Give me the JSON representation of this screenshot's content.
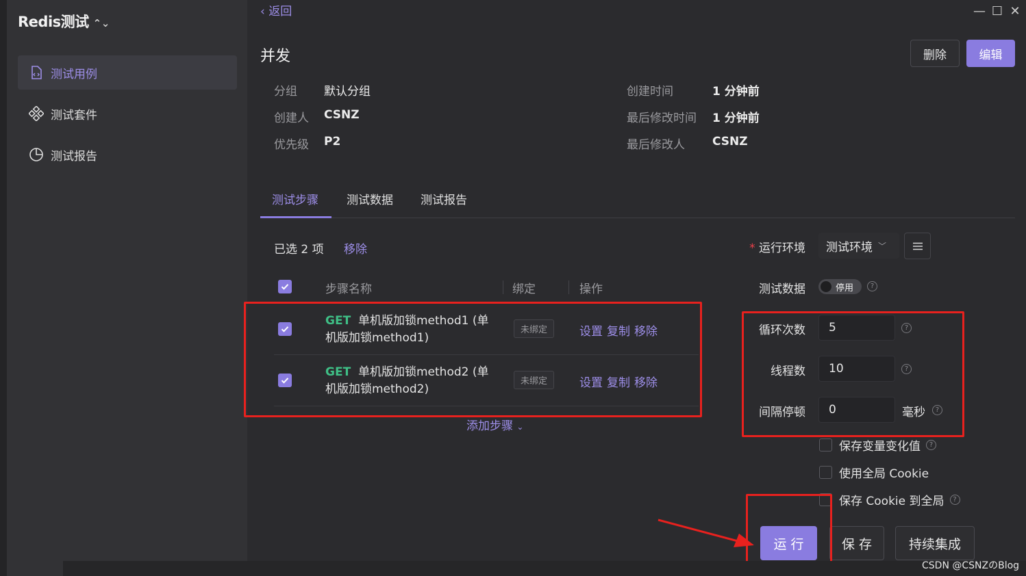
{
  "sidebar": {
    "app_title": "Redis测试",
    "items": [
      {
        "label": "测试用例",
        "icon": "file-code-icon"
      },
      {
        "label": "测试套件",
        "icon": "suite-icon"
      },
      {
        "label": "测试报告",
        "icon": "pie-chart-icon"
      }
    ]
  },
  "header": {
    "back_label": "返回",
    "title": "并发",
    "delete_label": "删除",
    "edit_label": "编辑"
  },
  "meta": {
    "group_label": "分组",
    "group_value": "默认分组",
    "creator_label": "创建人",
    "creator_value": "CSNZ",
    "priority_label": "优先级",
    "priority_value": "P2",
    "created_label": "创建时间",
    "created_value": "1 分钟前",
    "modified_label": "最后修改时间",
    "modified_value": "1 分钟前",
    "modifier_label": "最后修改人",
    "modifier_value": "CSNZ"
  },
  "tabs": [
    "测试步骤",
    "测试数据",
    "测试报告"
  ],
  "steps": {
    "selected_text": "已选 2 项",
    "remove_label": "移除",
    "columns": [
      "步骤名称",
      "绑定",
      "操作"
    ],
    "rows": [
      {
        "method": "GET",
        "name": "单机版加锁method1 (单机版加锁method1)",
        "bind": "未绑定",
        "actions": [
          "设置",
          "复制",
          "移除"
        ]
      },
      {
        "method": "GET",
        "name": "单机版加锁method2 (单机版加锁method2)",
        "bind": "未绑定",
        "actions": [
          "设置",
          "复制",
          "移除"
        ]
      }
    ],
    "add_step_label": "添加步骤"
  },
  "run_config": {
    "env_label": "运行环境",
    "env_value": "测试环境",
    "data_label": "测试数据",
    "data_toggle": "停用",
    "loop_label": "循环次数",
    "loop_value": "5",
    "threads_label": "线程数",
    "threads_value": "10",
    "interval_label": "间隔停顿",
    "interval_value": "0",
    "interval_unit": "毫秒",
    "opt_save_vars": "保存变量变化值",
    "opt_global_cookie": "使用全局 Cookie",
    "opt_save_cookie": "保存 Cookie 到全局",
    "run_label": "运 行",
    "save_label": "保 存",
    "ci_label": "持续集成"
  },
  "watermark": "CSDN @CSNZのBlog",
  "colors": {
    "accent": "#8a7ce0",
    "method_get": "#3fbf86",
    "annotation_red": "#e8211e"
  }
}
